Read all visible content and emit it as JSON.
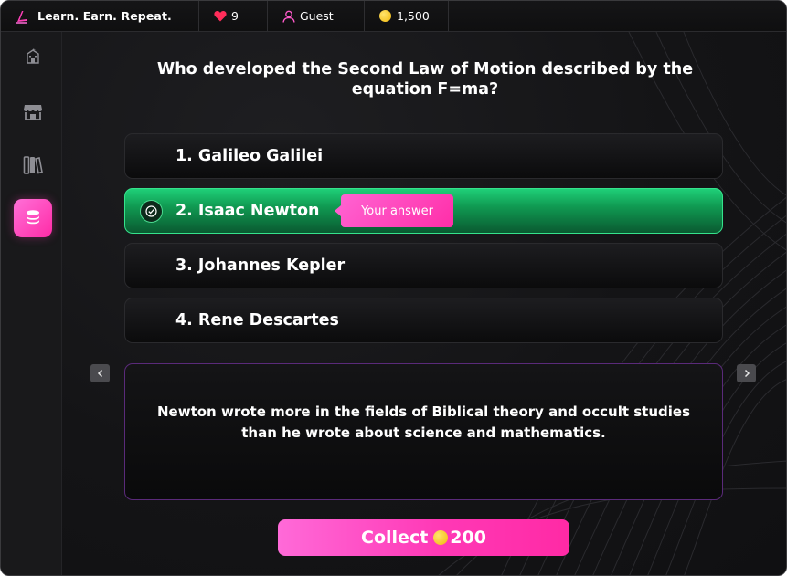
{
  "header": {
    "title": "Learn. Earn. Repeat.",
    "lives": "9",
    "user": "Guest",
    "coins": "1,500"
  },
  "sidebar": {
    "items": [
      {
        "icon": "school-icon",
        "active": false
      },
      {
        "icon": "store-icon",
        "active": false
      },
      {
        "icon": "library-icon",
        "active": false
      },
      {
        "icon": "coins-stack-icon",
        "active": true
      }
    ]
  },
  "quiz": {
    "question": "Who developed the Second Law of Motion described by the equation F=ma?",
    "options": [
      {
        "label": "1. Galileo Galilei"
      },
      {
        "label": "2. Isaac Newton"
      },
      {
        "label": "3. Johannes Kepler"
      },
      {
        "label": "4. Rene Descartes"
      }
    ],
    "your_answer_label": "Your answer",
    "fact": "Newton wrote more in the fields of Biblical theory and occult studies than he wrote about science and mathematics.",
    "collect_label": "Collect",
    "collect_amount": "200"
  },
  "colors": {
    "accent": "#ff3fb8",
    "correct": "#1fcf78",
    "coin": "#f5c518"
  }
}
